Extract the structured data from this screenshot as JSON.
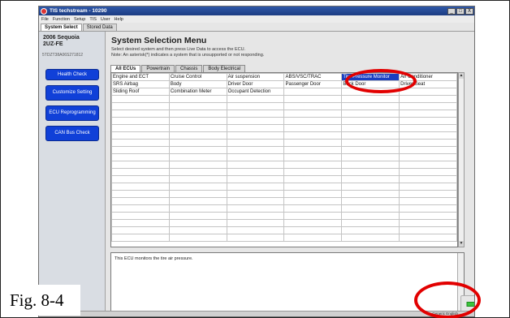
{
  "window": {
    "title": "TIS techstream - 10290",
    "buttons": [
      "_",
      "□",
      "X"
    ]
  },
  "menubar": [
    "File",
    "Function",
    "Setup",
    "TIS",
    "User",
    "Help"
  ],
  "top_tabs": [
    {
      "label": "System Select",
      "active": true
    },
    {
      "label": "Stored Data",
      "active": false
    }
  ],
  "sidebar": {
    "vehicle": "2006 Sequoia",
    "engine": "2UZ-FE",
    "vin": "5TDZT38A06S271812",
    "buttons": [
      {
        "label": "Health Check"
      },
      {
        "label": "Customize Setting"
      },
      {
        "label": "ECU Reprogramming"
      },
      {
        "label": "CAN Bus Check"
      }
    ]
  },
  "main": {
    "title": "System Selection Menu",
    "instruction_1": "Select desired system and then press Live Data to access the ECU.",
    "instruction_2": "Note: An asterisk(*) indicates a system that is unsupported or not responding."
  },
  "ecu_tabs": [
    {
      "label": "All ECUs",
      "active": true
    },
    {
      "label": "Powertrain",
      "active": false
    },
    {
      "label": "Chassis",
      "active": false
    },
    {
      "label": "Body Electrical",
      "active": false
    }
  ],
  "ecu_grid": {
    "rows": [
      [
        "Engine and ECT",
        "Cruise Control",
        "Air suspension",
        "ABS/VSC/TRAC",
        "Tire Pressure Monitor",
        "Air Conditioner"
      ],
      [
        "SRS Airbag",
        "Body",
        "Driver Door",
        "Passenger Door",
        "Back Door",
        "Driver Seat"
      ],
      [
        "Sliding Roof",
        "Combination Meter",
        "Occupant Detection",
        "",
        "",
        ""
      ]
    ],
    "selected": "Tire Pressure Monitor",
    "empty_rows": 20
  },
  "description": "This ECU monitors the tire air pressure.",
  "status": "Generic English",
  "figure_label": "Fig. 8-4",
  "colors": {
    "nav_button": "#1040d8",
    "selection": "#1a3fc0",
    "highlight_circle": "#e20000",
    "next_arrow": "#3cc43c"
  }
}
